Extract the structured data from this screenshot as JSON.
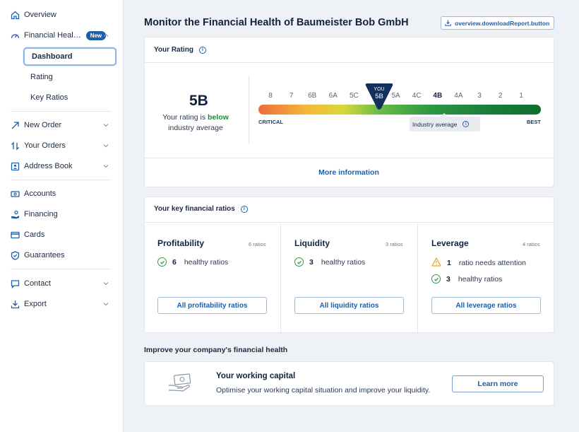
{
  "sidebar": {
    "items": [
      {
        "label": "Overview",
        "icon": "home-icon"
      },
      {
        "label": "Financial Heal…",
        "icon": "gauge-icon",
        "badge": "New",
        "expanded": true
      },
      {
        "label": "New Order",
        "icon": "arrow-up-right-icon"
      },
      {
        "label": "Your Orders",
        "icon": "swap-icon"
      },
      {
        "label": "Address Book",
        "icon": "contact-card-icon"
      },
      {
        "label": "Accounts",
        "icon": "bank-note-icon"
      },
      {
        "label": "Financing",
        "icon": "hand-coin-icon"
      },
      {
        "label": "Cards",
        "icon": "credit-card-icon"
      },
      {
        "label": "Guarantees",
        "icon": "shield-icon"
      },
      {
        "label": "Contact",
        "icon": "chat-icon"
      },
      {
        "label": "Export",
        "icon": "download-icon"
      }
    ],
    "sub_items": [
      {
        "label": "Dashboard",
        "active": true
      },
      {
        "label": "Rating",
        "active": false
      },
      {
        "label": "Key Ratios",
        "active": false
      }
    ]
  },
  "header": {
    "title": "Monitor the Financial Health of Baumeister Bob GmbH",
    "download_label": "overview.downloadReport.button"
  },
  "rating": {
    "card_title": "Your Rating",
    "value": "5B",
    "text_prefix": "Your rating is ",
    "text_emphasis": "below",
    "text_suffix": "industry average",
    "scale": [
      "8",
      "7",
      "6B",
      "6A",
      "5C",
      "5B",
      "5A",
      "4C",
      "4B",
      "4A",
      "3",
      "2",
      "1"
    ],
    "you_label": "YOU",
    "critical_label": "CRITICAL",
    "best_label": "BEST",
    "industry_average_label": "Industry average",
    "industry_average_value": "4B",
    "more_info": "More information"
  },
  "key_ratios": {
    "card_title": "Your key financial ratios",
    "columns": [
      {
        "title": "Profitability",
        "count": "6 ratios",
        "lines": [
          {
            "status": "healthy",
            "num": "6",
            "text": "healthy ratios"
          }
        ],
        "button": "All profitability ratios"
      },
      {
        "title": "Liquidity",
        "count": "3 ratios",
        "lines": [
          {
            "status": "healthy",
            "num": "3",
            "text": "healthy ratios"
          }
        ],
        "button": "All liquidity ratios"
      },
      {
        "title": "Leverage",
        "count": "4 ratios",
        "lines": [
          {
            "status": "attention",
            "num": "1",
            "text": "ratio needs attention"
          },
          {
            "status": "healthy",
            "num": "3",
            "text": "healthy ratios"
          }
        ],
        "button": "All leverage ratios"
      }
    ]
  },
  "improve": {
    "section_title": "Improve your company's financial health",
    "card_title": "Your working capital",
    "card_text": "Optimise your working capital situation and improve your liquidity.",
    "button": "Learn more"
  },
  "colors": {
    "accent": "#1e5fa8",
    "positive": "#2d9a43",
    "warning": "#e5a82a",
    "marker": "#12305c"
  }
}
